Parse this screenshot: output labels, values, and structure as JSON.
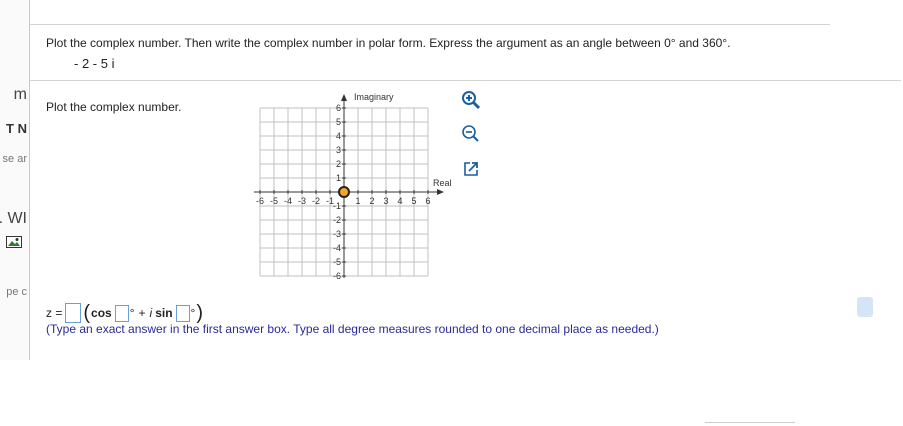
{
  "left_strip": {
    "fragments": [
      "m",
      "T N",
      "se ar",
      ". WI",
      "pe c"
    ]
  },
  "question": {
    "instruction": "Plot the complex number.  Then write the complex number in polar form.  Express the argument as an angle between 0° and 360°.",
    "number": "- 2 - 5 i"
  },
  "plot": {
    "label": "Plot the complex number.",
    "imaginary_axis_label": "Imaginary",
    "real_axis_label": "Real",
    "x_ticks": [
      "-6",
      "-5",
      "-4",
      "-3",
      "-2",
      "-1",
      "1",
      "2",
      "3",
      "4",
      "5",
      "6"
    ],
    "y_ticks": [
      "6",
      "5",
      "4",
      "3",
      "2",
      "1",
      "-1",
      "-2",
      "-3",
      "-4",
      "-5",
      "-6"
    ],
    "point_color": "#f5a623",
    "grid_color": "#c0c0c0"
  },
  "tools": {
    "zoom_in": "zoom-in-icon",
    "zoom_out": "zoom-out-icon",
    "popout": "popout-icon"
  },
  "answer": {
    "z_label": "z =",
    "cos_label": "cos",
    "deg1": "°",
    "plus": "+",
    "i_label": "i",
    "sin_label": "sin",
    "deg2": "°",
    "instructions": "(Type an exact answer in the first answer box.  Type all degree measures rounded to one decimal place as needed.)"
  },
  "colors": {
    "instruction_text": "#2a2a9a",
    "input_border": "#6aa0d8",
    "tool_blue": "#1a5f9e"
  }
}
